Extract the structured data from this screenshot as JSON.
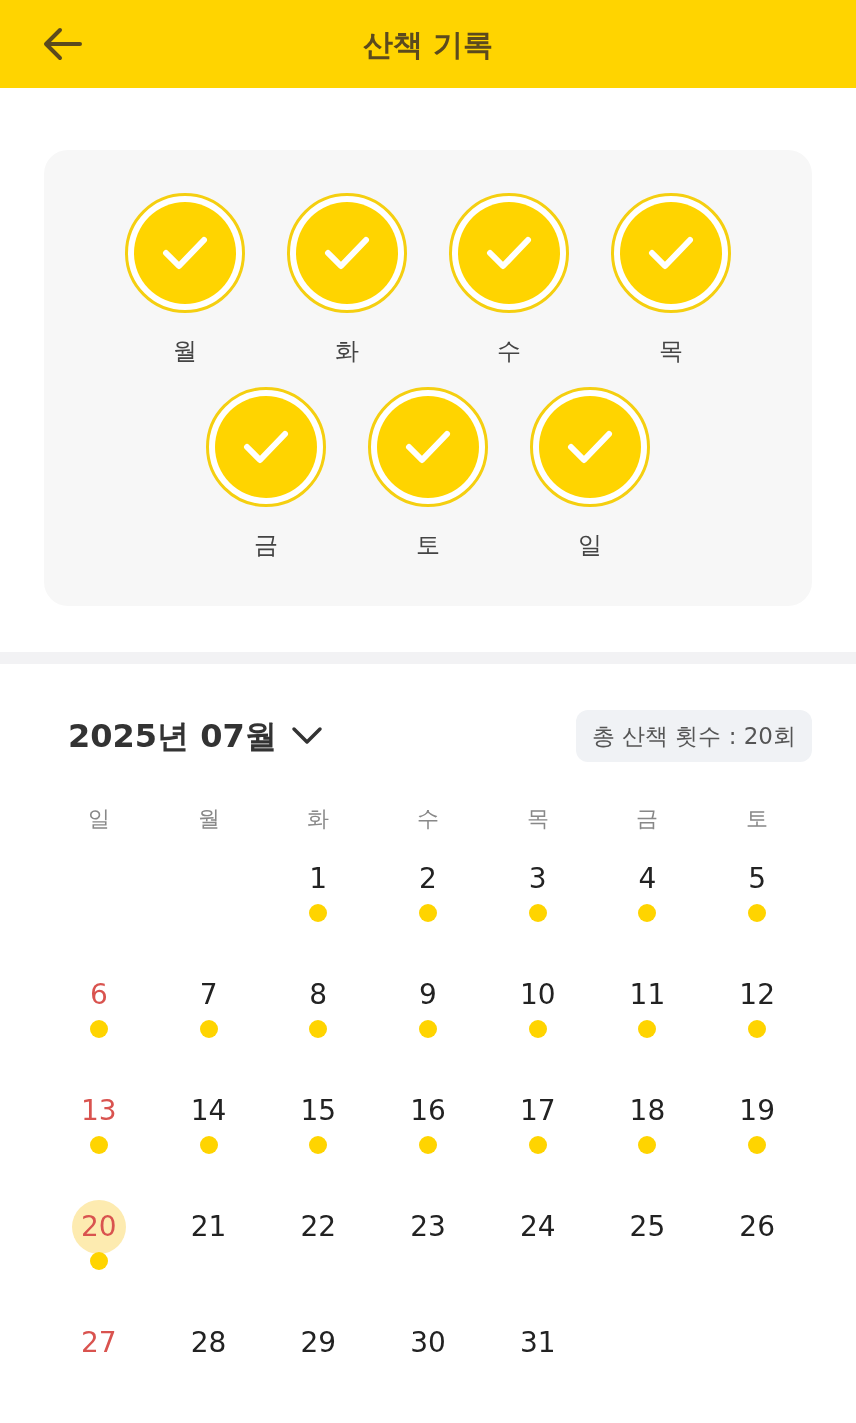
{
  "header": {
    "title": "산책 기록"
  },
  "week_days": [
    {
      "label": "월",
      "checked": true
    },
    {
      "label": "화",
      "checked": true
    },
    {
      "label": "수",
      "checked": true
    },
    {
      "label": "목",
      "checked": true
    },
    {
      "label": "금",
      "checked": true
    },
    {
      "label": "토",
      "checked": true
    },
    {
      "label": "일",
      "checked": true
    }
  ],
  "calendar": {
    "month": "2025년 07월",
    "total": "총 산책 횟수 : 20회",
    "weekdays": [
      "일",
      "월",
      "화",
      "수",
      "목",
      "금",
      "토"
    ],
    "weeks": [
      [
        {
          "kind": "blank"
        },
        {
          "kind": "blank"
        },
        {
          "kind": "day",
          "day": "1",
          "walked": true,
          "today": false
        },
        {
          "kind": "day",
          "day": "2",
          "walked": true,
          "today": false
        },
        {
          "kind": "day",
          "day": "3",
          "walked": true,
          "today": false
        },
        {
          "kind": "day",
          "day": "4",
          "walked": true,
          "today": false
        },
        {
          "kind": "day",
          "day": "5",
          "walked": true,
          "today": false
        }
      ],
      [
        {
          "kind": "day",
          "day": "6",
          "walked": true,
          "today": false
        },
        {
          "kind": "day",
          "day": "7",
          "walked": true,
          "today": false
        },
        {
          "kind": "day",
          "day": "8",
          "walked": true,
          "today": false
        },
        {
          "kind": "day",
          "day": "9",
          "walked": true,
          "today": false
        },
        {
          "kind": "day",
          "day": "10",
          "walked": true,
          "today": false
        },
        {
          "kind": "day",
          "day": "11",
          "walked": true,
          "today": false
        },
        {
          "kind": "day",
          "day": "12",
          "walked": true,
          "today": false
        }
      ],
      [
        {
          "kind": "day",
          "day": "13",
          "walked": true,
          "today": false
        },
        {
          "kind": "day",
          "day": "14",
          "walked": true,
          "today": false
        },
        {
          "kind": "day",
          "day": "15",
          "walked": true,
          "today": false
        },
        {
          "kind": "day",
          "day": "16",
          "walked": true,
          "today": false
        },
        {
          "kind": "day",
          "day": "17",
          "walked": true,
          "today": false
        },
        {
          "kind": "day",
          "day": "18",
          "walked": true,
          "today": false
        },
        {
          "kind": "day",
          "day": "19",
          "walked": true,
          "today": false
        }
      ],
      [
        {
          "kind": "day",
          "day": "20",
          "walked": true,
          "today": true
        },
        {
          "kind": "day",
          "day": "21",
          "walked": false,
          "today": false
        },
        {
          "kind": "day",
          "day": "22",
          "walked": false,
          "today": false
        },
        {
          "kind": "day",
          "day": "23",
          "walked": false,
          "today": false
        },
        {
          "kind": "day",
          "day": "24",
          "walked": false,
          "today": false
        },
        {
          "kind": "day",
          "day": "25",
          "walked": false,
          "today": false
        },
        {
          "kind": "day",
          "day": "26",
          "walked": false,
          "today": false
        }
      ],
      [
        {
          "kind": "day",
          "day": "27",
          "walked": false,
          "today": false
        },
        {
          "kind": "day",
          "day": "28",
          "walked": false,
          "today": false
        },
        {
          "kind": "day",
          "day": "29",
          "walked": false,
          "today": false
        },
        {
          "kind": "day",
          "day": "30",
          "walked": false,
          "today": false
        },
        {
          "kind": "day",
          "day": "31",
          "walked": false,
          "today": false
        }
      ]
    ]
  }
}
